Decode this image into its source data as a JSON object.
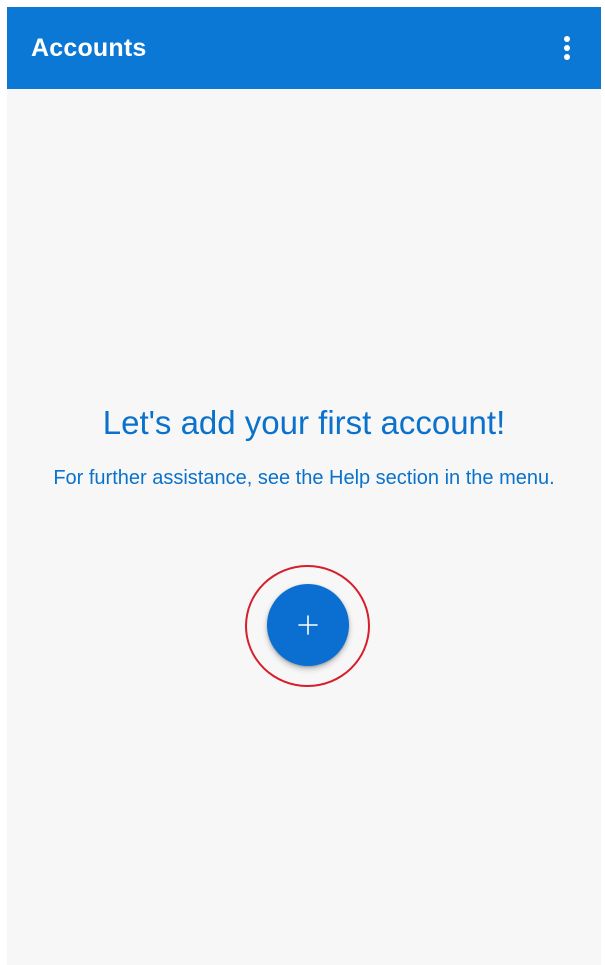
{
  "app_bar": {
    "title": "Accounts",
    "menu_icon": "more-vertical-icon",
    "color": "#0a78d4"
  },
  "empty_state": {
    "headline": "Let's add your first account!",
    "subtext": "For further assistance, see the Help section in the menu.",
    "text_color": "#0a72cc"
  },
  "add_button": {
    "icon": "plus-icon",
    "color": "#0a6fd0",
    "highlight_ring_color": "#d61f2c"
  },
  "background_color": "#f7f7f7"
}
